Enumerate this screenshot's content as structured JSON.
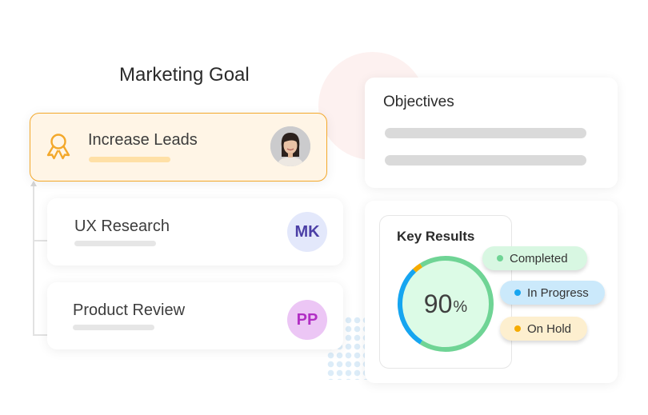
{
  "left_panel": {
    "title": "Marketing Goal",
    "goal": {
      "label": "Increase Leads",
      "icon": "award-ribbon-icon",
      "accent": "#f3a82b",
      "background": "#fff5e6"
    },
    "tasks": [
      {
        "label": "UX Research",
        "initials": "MK",
        "avatar_bg": "#e3e8fb",
        "avatar_color": "#4b3fa6"
      },
      {
        "label": "Product Review",
        "initials": "PP",
        "avatar_bg": "#ecc6f5",
        "avatar_color": "#b12ec4"
      }
    ]
  },
  "objectives": {
    "title": "Objectives"
  },
  "key_results": {
    "title": "Key Results",
    "percent_value": "90",
    "percent_sign": "%",
    "segments": [
      {
        "name": "Completed",
        "fraction": 0.68,
        "color": "#6fd495"
      },
      {
        "name": "In Progress",
        "fraction": 0.29,
        "color": "#16a5f0"
      },
      {
        "name": "On Hold",
        "fraction": 0.03,
        "color": "#f5ab00"
      }
    ],
    "legend": [
      {
        "label": "Completed",
        "dot": "#6fd495",
        "bg": "#d8f7e2"
      },
      {
        "label": "In Progress",
        "dot": "#16a5f0",
        "bg": "#cbe9fb"
      },
      {
        "label": "On Hold",
        "dot": "#f5ab00",
        "bg": "#fdefcf"
      }
    ]
  }
}
